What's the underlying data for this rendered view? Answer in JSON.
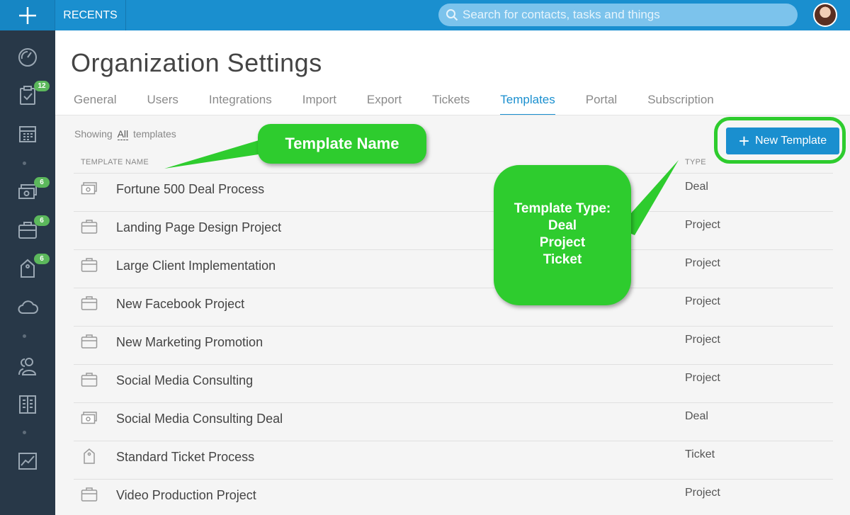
{
  "topbar": {
    "recents_label": "RECENTS",
    "search_placeholder": "Search for contacts, tasks and things"
  },
  "sidebar": {
    "items": [
      {
        "icon": "dashboard-icon"
      },
      {
        "icon": "tasks-icon",
        "badge": "12"
      },
      {
        "icon": "calendar-icon"
      },
      {
        "icon": "deals-icon",
        "badge": "6"
      },
      {
        "icon": "projects-icon",
        "badge": "6"
      },
      {
        "icon": "tickets-icon",
        "badge": "6"
      },
      {
        "icon": "cloud-icon"
      },
      {
        "icon": "contacts-icon"
      },
      {
        "icon": "organizations-icon"
      },
      {
        "icon": "reports-icon"
      }
    ]
  },
  "page": {
    "title": "Organization Settings"
  },
  "tabs": [
    {
      "label": "General"
    },
    {
      "label": "Users"
    },
    {
      "label": "Integrations"
    },
    {
      "label": "Import"
    },
    {
      "label": "Export"
    },
    {
      "label": "Tickets"
    },
    {
      "label": "Templates",
      "active": true
    },
    {
      "label": "Portal"
    },
    {
      "label": "Subscription"
    }
  ],
  "filter": {
    "prefix": "Showing",
    "value": "All",
    "suffix": "templates"
  },
  "new_template_button": "New Template",
  "table": {
    "headers": {
      "name": "TEMPLATE NAME",
      "type": "TYPE"
    },
    "rows": [
      {
        "name": "Fortune 500 Deal Process",
        "type": "Deal",
        "icon": "deal-icon"
      },
      {
        "name": "Landing Page Design Project",
        "type": "Project",
        "icon": "briefcase-icon"
      },
      {
        "name": "Large Client Implementation",
        "type": "Project",
        "icon": "briefcase-icon"
      },
      {
        "name": "New Facebook Project",
        "type": "Project",
        "icon": "briefcase-icon"
      },
      {
        "name": "New Marketing Promotion",
        "type": "Project",
        "icon": "briefcase-icon"
      },
      {
        "name": "Social Media Consulting",
        "type": "Project",
        "icon": "briefcase-icon"
      },
      {
        "name": "Social Media Consulting Deal",
        "type": "Deal",
        "icon": "deal-icon"
      },
      {
        "name": "Standard Ticket Process",
        "type": "Ticket",
        "icon": "ticket-icon"
      },
      {
        "name": "Video Production Project",
        "type": "Project",
        "icon": "briefcase-icon"
      }
    ]
  },
  "annotations": {
    "name_callout": "Template Name",
    "type_callout": [
      "Template Type:",
      "Deal",
      "Project",
      "Ticket"
    ],
    "color": "#2ecc2e"
  }
}
